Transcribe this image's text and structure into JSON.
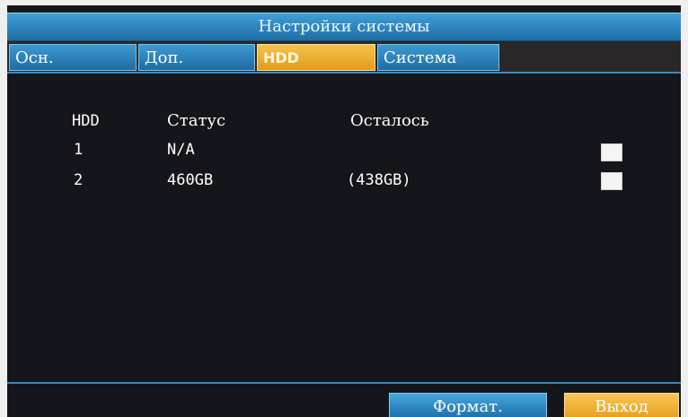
{
  "window": {
    "title": "Настройки системы"
  },
  "tabs": [
    {
      "label": "Осн.",
      "active": false
    },
    {
      "label": "Доп.",
      "active": false
    },
    {
      "label": "HDD",
      "active": true
    },
    {
      "label": "Система",
      "active": false
    }
  ],
  "table": {
    "headers": {
      "hdd": "HDD",
      "status": "Статус",
      "remaining": "Осталось"
    },
    "rows": [
      {
        "hdd": "1",
        "status": "N/A",
        "remaining": "",
        "checked": false
      },
      {
        "hdd": "2",
        "status": "460GB",
        "remaining": "(438GB)",
        "checked": false
      }
    ]
  },
  "buttons": {
    "format": "Формат.",
    "exit": "Выход"
  },
  "colors": {
    "accent_blue": "#2a86c4",
    "accent_orange": "#f0a92c",
    "background": "#15161b"
  }
}
